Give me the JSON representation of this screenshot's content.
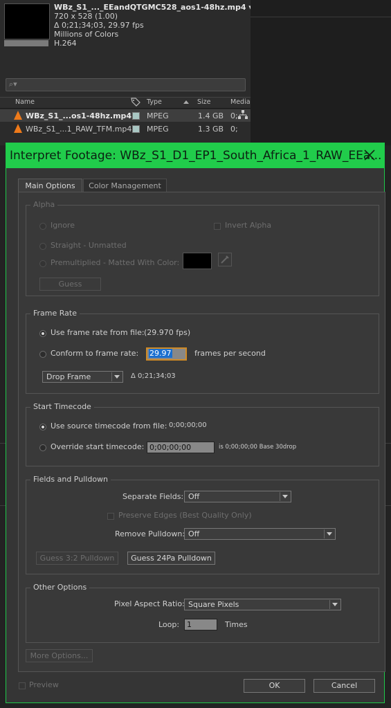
{
  "project": {
    "file_name": "WBz_S1_..._EEandQTGMC528_aos1-48hz.mp4 ▾",
    "resolution": "720 x 528 (1.00)",
    "duration": "Δ 0;21;34;03, 29.97 fps",
    "colors": "Millions of Colors",
    "codec": "H.264",
    "search_placeholder": "⌕▾",
    "columns": {
      "name": "Name",
      "type": "Type",
      "size": "Size",
      "media": "Media"
    },
    "items": [
      {
        "name": "WBz_S1_...os1-48hz.mp4",
        "type": "MPEG",
        "size": "1.4 GB",
        "media": "0;"
      },
      {
        "name": "WBz_S1_...1_RAW_TFM.mp4",
        "type": "MPEG",
        "size": "1.3 GB",
        "media": "0;"
      }
    ]
  },
  "dialog": {
    "title": "Interpret Footage: WBz_S1_D1_EP1_South_Africa_1_RAW_EEa...",
    "tabs": {
      "main": "Main Options",
      "color": "Color Management"
    },
    "alpha": {
      "legend": "Alpha",
      "ignore": "Ignore",
      "invert": "Invert Alpha",
      "straight": "Straight - Unmatted",
      "premultiplied": "Premultiplied - Matted With Color:",
      "guess": "Guess"
    },
    "frame_rate": {
      "legend": "Frame Rate",
      "use_file": "Use frame rate from file:",
      "file_fps": "(29.970 fps)",
      "conform": "Conform to frame rate:",
      "conform_value": "29.97",
      "units": "frames per second",
      "drop_frame": "Drop Frame",
      "duration": "Δ 0;21;34;03"
    },
    "start_timecode": {
      "legend": "Start Timecode",
      "use_source": "Use source timecode from file:",
      "source_value": "0;00;00;00",
      "override": "Override start timecode:",
      "override_value": "0;00;00;00",
      "note": "is 0;00;00;00  Base 30drop"
    },
    "fields": {
      "legend": "Fields and Pulldown",
      "separate_label": "Separate Fields:",
      "separate_value": "Off",
      "preserve": "Preserve Edges (Best Quality Only)",
      "remove_label": "Remove Pulldown:",
      "remove_value": "Off",
      "guess32": "Guess 3:2 Pulldown",
      "guess24": "Guess 24Pa Pulldown"
    },
    "other": {
      "legend": "Other Options",
      "par_label": "Pixel Aspect Ratio:",
      "par_value": "Square Pixels",
      "loop_label": "Loop:",
      "loop_value": "1",
      "times": "Times"
    },
    "more_options": "More Options...",
    "preview": "Preview",
    "ok": "OK",
    "cancel": "Cancel"
  },
  "colors": {
    "title_bar": "#21cc4b",
    "selection": "#1a6fd0"
  }
}
